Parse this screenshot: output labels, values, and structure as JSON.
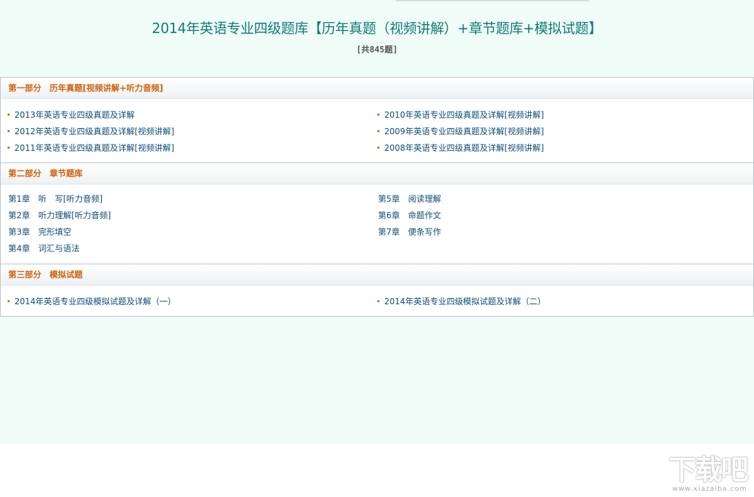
{
  "header": {
    "title": "2014年英语专业四级题库【历年真题（视频讲解）+章节题库+模拟试题】",
    "count": "[共845题]"
  },
  "sections": [
    {
      "heading": "第一部分　历年真题[视频讲解+听力音频]",
      "left": [
        "2013年英语专业四级真题及详解",
        "2012年英语专业四级真题及详解[视频讲解]",
        "2011年英语专业四级真题及详解[视频讲解]"
      ],
      "right": [
        "2010年英语专业四级真题及详解[视频讲解]",
        "2009年英语专业四级真题及详解[视频讲解]",
        "2008年英语专业四级真题及详解[视频讲解]"
      ]
    },
    {
      "heading": "第二部分　章节题库",
      "left": [
        "第1章　听　写[听力音频]",
        "第2章　听力理解[听力音频]",
        "第3章　完形填空",
        "第4章　词汇与语法"
      ],
      "right": [
        "第5章　阅读理解",
        "第6章　命题作文",
        "第7章　便条写作"
      ]
    },
    {
      "heading": "第三部分　模拟试题",
      "left": [
        "2014年英语专业四级模拟试题及详解（一）"
      ],
      "right": [
        "2014年英语专业四级模拟试题及详解（二）"
      ]
    }
  ],
  "watermark": {
    "text": "下载吧",
    "url": "www.xiazaiba.com"
  },
  "colors": {
    "page_bg": "#effcf8",
    "title": "#137a75",
    "section_heading": "#d0620f",
    "link": "#0c4b76",
    "bullet": "#d96a1b"
  }
}
